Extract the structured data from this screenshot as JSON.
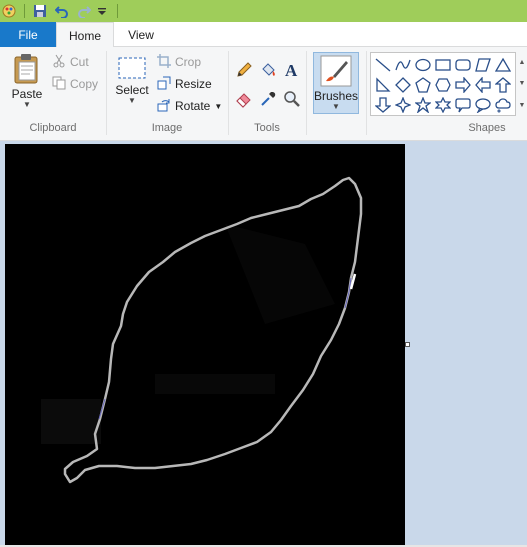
{
  "quick_access": {
    "icons": [
      "paint-app-icon",
      "save-icon",
      "undo-icon",
      "redo-icon",
      "customize-dropdown-icon"
    ]
  },
  "tabs": {
    "file": "File",
    "home": "Home",
    "view": "View"
  },
  "clipboard": {
    "paste": "Paste",
    "cut": "Cut",
    "copy": "Copy",
    "group_label": "Clipboard"
  },
  "image": {
    "select": "Select",
    "crop": "Crop",
    "resize": "Resize",
    "rotate": "Rotate",
    "group_label": "Image"
  },
  "tools": {
    "items": [
      "pencil",
      "fill",
      "text",
      "eraser",
      "color-picker",
      "magnifier"
    ],
    "group_label": "Tools"
  },
  "brushes": {
    "label": "Brushes"
  },
  "shapes": {
    "group_label": "Shapes",
    "items": [
      "line",
      "curve",
      "oval",
      "rectangle",
      "rounded-rectangle",
      "polygon",
      "triangle",
      "right-triangle",
      "diamond",
      "pentagon",
      "hexagon",
      "right-arrow",
      "left-arrow",
      "up-arrow",
      "down-arrow",
      "four-point-star",
      "five-point-star",
      "six-point-star",
      "rounded-callout",
      "oval-callout",
      "cloud-callout"
    ]
  },
  "colors": {
    "titlebar": "#9fcd5a",
    "file_tab": "#1979ca",
    "ribbon": "#f5f6f7",
    "workspace": "#c9d8ea",
    "canvas": "#000000",
    "leaf_outline": "#b8b8b8"
  }
}
